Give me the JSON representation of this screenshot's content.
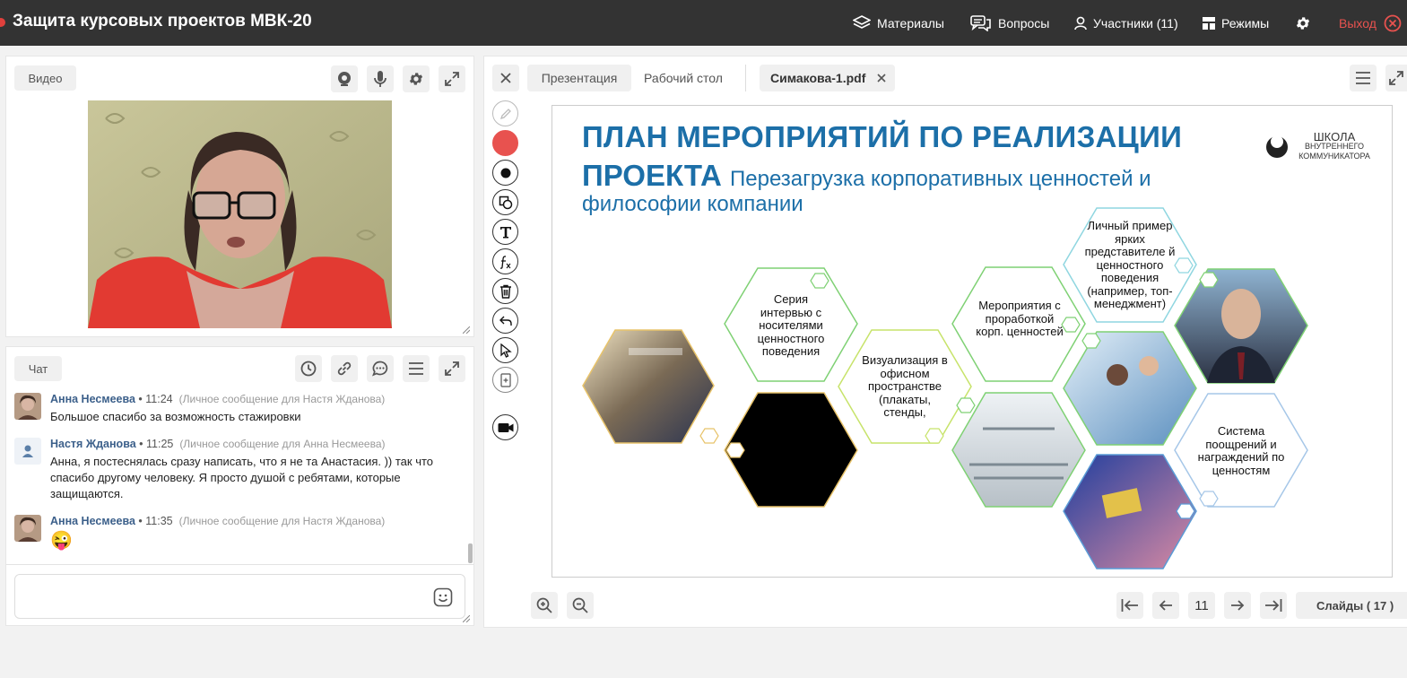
{
  "header": {
    "title": "Защита курсовых проектов МВК-20",
    "materials": "Материалы",
    "questions": "Вопросы",
    "participants": "Участники (11)",
    "modes": "Режимы",
    "exit": "Выход"
  },
  "video": {
    "label": "Видео"
  },
  "chat": {
    "label": "Чат",
    "messages": [
      {
        "author": "Анна Несмеева",
        "time": "11:24",
        "pm": "(Личное сообщение для Настя Жданова)",
        "text": "Большое спасибо за возможность стажировки"
      },
      {
        "author": "Настя Жданова",
        "time": "11:25",
        "pm": "(Личное сообщение для Анна Несмеева)",
        "text": "Анна, я постеснялась сразу написать, что я не та Анастасия. )) так что спасибо другому человеку. Я просто душой с ребятами, которые защищаются."
      },
      {
        "author": "Анна Несмеева",
        "time": "11:35",
        "pm": "(Личное сообщение для Настя Жданова)",
        "text": "😜"
      }
    ]
  },
  "presentation": {
    "tab_presentation": "Презентация",
    "tab_desktop": "Рабочий стол",
    "file_tab": "Симакова-1.pdf",
    "current_slide": "11",
    "slides_label": "Слайды ( 17 )"
  },
  "slide": {
    "title_line1": "ПЛАН МЕРОПРИЯТИЙ ПО РЕАЛИЗАЦИИ",
    "title_line2_bold": "ПРОЕКТА",
    "title_line2_rest": "Перезагрузка корпоративных ценностей и",
    "title_line3": "философии компании",
    "logo_line1": "ШКОЛА",
    "logo_line2": "ВНУТРЕННЕГО",
    "logo_line3": "КОММУНИКАТОРА",
    "hex_interview": "Серия интервью с носителями ценностного поведения",
    "hex_visual": "Визуализация в офисном пространстве (плакаты, стенды,",
    "hex_events": "Мероприятия с проработкой корп. ценностей",
    "hex_example": "Личный пример ярких представителе й ценностного поведения (например, топ-менеджмент)",
    "hex_rewards": "Система поощрений и награждений по ценностям"
  },
  "colors": {
    "topbar": "#333333",
    "accent_red": "#e8524f",
    "slide_title": "#1c6fa8"
  }
}
